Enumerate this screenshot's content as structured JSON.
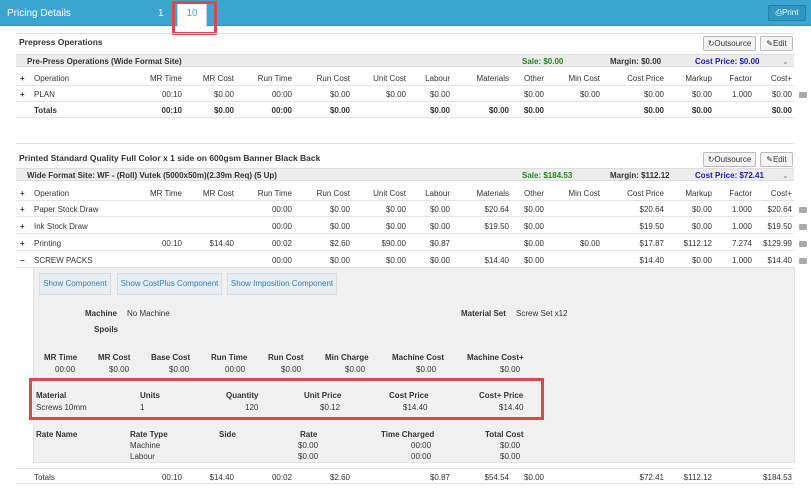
{
  "header": {
    "title": "Pricing Details",
    "tab1": "1",
    "tab10": "10",
    "print": "Print"
  },
  "prepress": {
    "title": "Prepress Operations",
    "outsource": "Outsource",
    "edit": "Edit",
    "site": "Pre-Press Operations (Wide Format Site)",
    "sale": "Sale: $0.00",
    "margin": "Margin: $0.00",
    "cost_price": "Cost Price: $0.00",
    "row": {
      "op": "PLAN",
      "mr": "00:10",
      "mrc": "$0.00",
      "run": "00:00",
      "runc": "$0.00",
      "unit": "$0.00",
      "labour": "$0.00",
      "mat": "",
      "other": "$0.00",
      "min": "$0.00",
      "cp": "$0.00",
      "mk": "$0.00",
      "fac": "1.000",
      "costp": "$0.00"
    },
    "totals": {
      "label": "Totals",
      "mr": "00:10",
      "mrc": "$0.00",
      "run": "00:00",
      "runc": "$0.00",
      "unit": "",
      "labour": "$0.00",
      "mat": "$0.00",
      "other": "$0.00",
      "min": "",
      "cp": "$0.00",
      "mk": "$0.00",
      "fac": "",
      "costp": "$0.00"
    }
  },
  "columns": {
    "op": "Operation",
    "mr": "MR Time",
    "mrc": "MR Cost",
    "run": "Run Time",
    "runc": "Run Cost",
    "unit": "Unit Cost",
    "labour": "Labour",
    "mat": "Materials",
    "other": "Other",
    "min": "Min Cost",
    "cp": "Cost Price",
    "mk": "Markup",
    "fac": "Factor",
    "costp": "Cost+"
  },
  "product": {
    "title": "Printed Standard Quality Full Color x 1 side on 600gsm Banner Black Back",
    "outsource": "Outsource",
    "edit": "Edit",
    "site": "Wide Format Site: WF - (Roll) Vutek (5000x50m)(2.39m Req) (5 Up)",
    "sale": "Sale: $184.53",
    "margin": "Margin: $112.12",
    "cost_price": "Cost Price: $72.41",
    "rows": [
      {
        "op": "Paper Stock Draw",
        "mr": "",
        "mrc": "",
        "run": "00:00",
        "runc": "$0.00",
        "unit": "$0.00",
        "labour": "$0.00",
        "mat": "$20.64",
        "other": "$0.00",
        "min": "",
        "cp": "$20.64",
        "mk": "$0.00",
        "fac": "1.000",
        "costp": "$20.64"
      },
      {
        "op": "Ink Stock Draw",
        "mr": "",
        "mrc": "",
        "run": "00:00",
        "runc": "$0.00",
        "unit": "$0.00",
        "labour": "$0.00",
        "mat": "$19.50",
        "other": "$0.00",
        "min": "",
        "cp": "$19.50",
        "mk": "$0.00",
        "fac": "1.000",
        "costp": "$19.50"
      },
      {
        "op": "Printing",
        "mr": "00:10",
        "mrc": "$14.40",
        "run": "00:02",
        "runc": "$2.60",
        "unit": "$90.00",
        "labour": "$0.87",
        "mat": "",
        "other": "$0.00",
        "min": "$0.00",
        "cp": "$17.87",
        "mk": "$112.12",
        "fac": "7.274",
        "costp": "$129.99"
      },
      {
        "op": "SCREW PACKS",
        "mr": "",
        "mrc": "",
        "run": "00:00",
        "runc": "$0.00",
        "unit": "$0.00",
        "labour": "$0.00",
        "mat": "$14.40",
        "other": "$0.00",
        "min": "",
        "cp": "$14.40",
        "mk": "$0.00",
        "fac": "1.000",
        "costp": "$14.40"
      }
    ],
    "totals": {
      "label": "Totals",
      "mr": "00:10",
      "mrc": "$14.40",
      "run": "00:02",
      "runc": "$2.60",
      "unit": "",
      "labour": "$0.87",
      "mat": "$54.54",
      "other": "$0.00",
      "min": "",
      "cp": "$72.41",
      "mk": "$112.12",
      "fac": "",
      "costp": "$184.53"
    }
  },
  "detail": {
    "btn1": "Show Component",
    "btn2": "Show CostPlus Component",
    "btn3": "Show Imposition Component",
    "machine_lbl": "Machine",
    "machine_val": "No Machine",
    "spoils_lbl": "Spoils",
    "matset_lbl": "Material Set",
    "matset_val": "Screw Set x12",
    "cost_hdr": [
      "MR Time",
      "MR Cost",
      "Base Cost",
      "Run Time",
      "Run Cost",
      "Min Charge",
      "Machine Cost",
      "Machine Cost+"
    ],
    "cost_val": [
      "00:00",
      "$0.00",
      "$0.00",
      "00:00",
      "$0.00",
      "$0.00",
      "$0.00",
      "$0.00"
    ],
    "mat_hdr": [
      "Material",
      "Units",
      "Quantity",
      "Unit Price",
      "Cost Price",
      "Cost+ Price"
    ],
    "mat_val": [
      "Screws 10mm",
      "1",
      "120",
      "$0.12",
      "$14.40",
      "$14.40"
    ],
    "rate_hdr": [
      "Rate Name",
      "Rate Type",
      "Side",
      "Rate",
      "Time Charged",
      "Total Cost"
    ],
    "rate_rows": [
      [
        "",
        "Machine",
        "",
        "$0.00",
        "00:00",
        "$0.00"
      ],
      [
        "",
        "Labour",
        "",
        "$0.00",
        "00:00",
        "$0.00"
      ]
    ]
  },
  "expand": {
    "plus": "+",
    "minus": "−"
  }
}
